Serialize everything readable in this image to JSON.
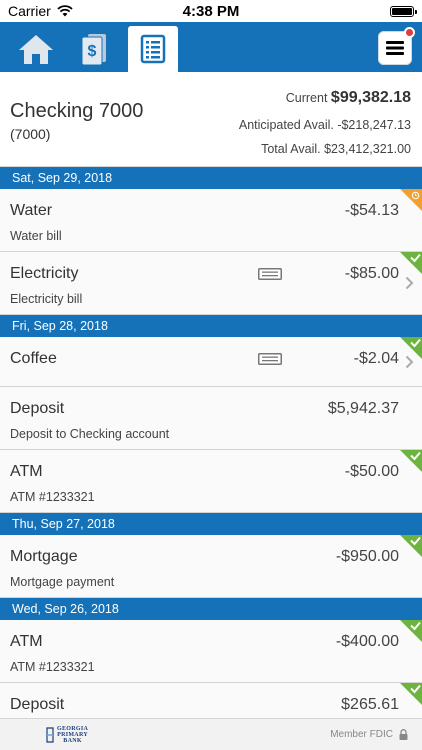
{
  "status_bar": {
    "carrier": "Carrier",
    "time": "4:38 PM"
  },
  "nav": {
    "tabs": [
      {
        "icon": "home-icon"
      },
      {
        "icon": "money-icon"
      },
      {
        "icon": "statement-icon",
        "active": true
      }
    ],
    "menu_icon": "hamburger-menu-icon",
    "notification": true
  },
  "account": {
    "name": "Checking 7000",
    "number": "(7000)",
    "current_label": "Current",
    "current_amount": "$99,382.18",
    "anticipated": "Anticipated Avail. -$218,247.13",
    "total": "Total Avail. $23,412,321.00"
  },
  "groups": [
    {
      "date": "Sat, Sep 29, 2018",
      "items": [
        {
          "name": "Water",
          "description": "Water bill",
          "amount": "-$54.13",
          "status": "pending"
        },
        {
          "name": "Electricity",
          "description": "Electricity bill",
          "amount": "-$85.00",
          "status": "cleared",
          "memo": true,
          "chevron": true
        }
      ]
    },
    {
      "date": "Fri, Sep 28, 2018",
      "items": [
        {
          "name": "Coffee",
          "description": "",
          "amount": "-$2.04",
          "status": "cleared",
          "memo": true,
          "chevron": true
        },
        {
          "name": "Deposit",
          "description": "Deposit to Checking account",
          "amount": "$5,942.37",
          "status": "none"
        },
        {
          "name": "ATM",
          "description": "ATM #1233321",
          "amount": "-$50.00",
          "status": "cleared"
        }
      ]
    },
    {
      "date": "Thu, Sep 27, 2018",
      "items": [
        {
          "name": "Mortgage",
          "description": "Mortgage payment",
          "amount": "-$950.00",
          "status": "cleared"
        }
      ]
    },
    {
      "date": "Wed, Sep 26, 2018",
      "items": [
        {
          "name": "ATM",
          "description": "ATM #1233321",
          "amount": "-$400.00",
          "status": "cleared"
        },
        {
          "name": "Deposit",
          "description": "",
          "amount": "$265.61",
          "status": "cleared"
        }
      ]
    }
  ],
  "footer": {
    "logo_lines": [
      "GEORGIA",
      "PRIMARY",
      "BANK"
    ],
    "fdic": "Member FDIC"
  },
  "colors": {
    "brand_blue": "#1572b9",
    "cleared_green": "#6db33f",
    "pending_orange": "#f0a030"
  }
}
